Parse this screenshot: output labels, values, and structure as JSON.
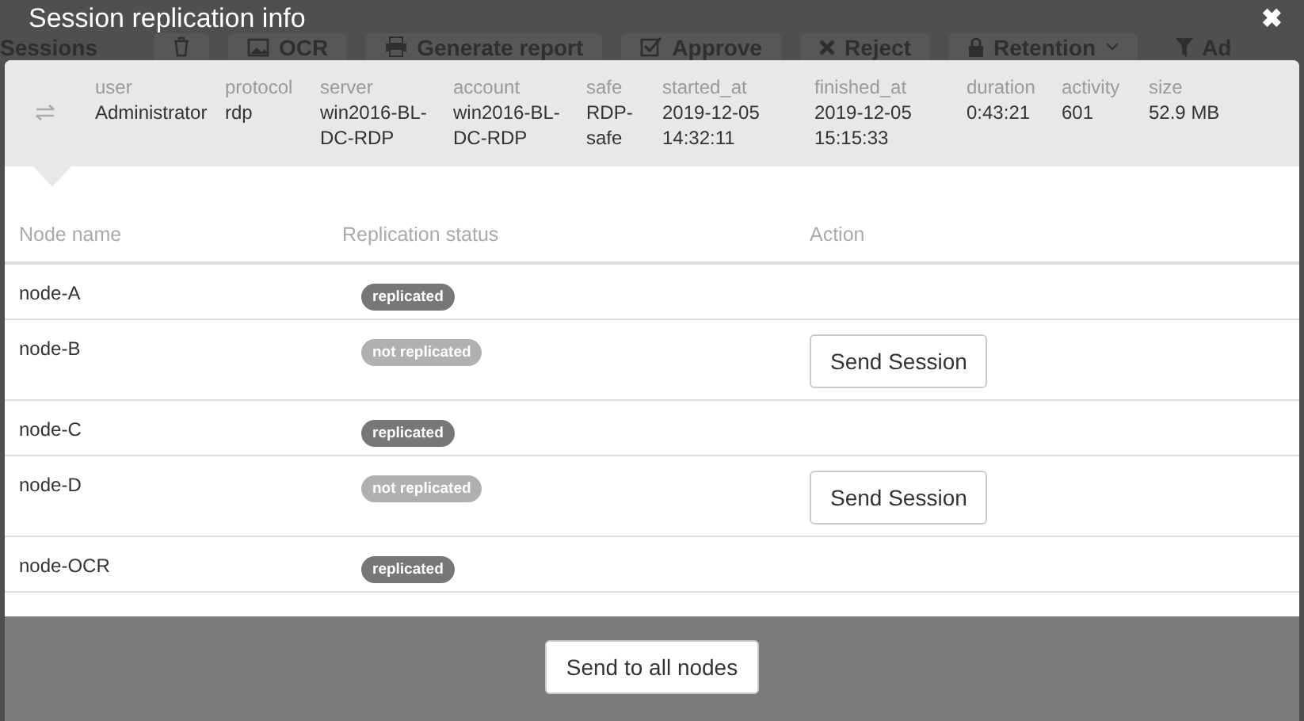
{
  "background": {
    "heading": "Sessions",
    "toolbar": [
      {
        "dropdown": false
      },
      {
        "label": "OCR",
        "dropdown": false
      },
      {
        "label": "Generate report",
        "dropdown": false
      },
      {
        "label": "Approve",
        "dropdown": false
      },
      {
        "label": "Reject",
        "dropdown": false
      },
      {
        "label": "Retention",
        "dropdown": true
      },
      {
        "label": "Ad",
        "dropdown": false
      }
    ]
  },
  "dialog": {
    "title": "Session replication info",
    "close": "✖",
    "session": [
      {
        "label": "user",
        "value": "Administrator"
      },
      {
        "label": "protocol",
        "value": "rdp"
      },
      {
        "label": "server",
        "value": "win2016-BL-DC-RDP"
      },
      {
        "label": "account",
        "value": "win2016-BL-DC-RDP"
      },
      {
        "label": "safe",
        "value": "RDP-safe"
      },
      {
        "label": "started_at",
        "value": "2019-12-05 14:32:11"
      },
      {
        "label": "finished_at",
        "value": "2019-12-05 15:15:33"
      },
      {
        "label": "duration",
        "value": "0:43:21"
      },
      {
        "label": "activity",
        "value": "601"
      },
      {
        "label": "size",
        "value": "52.9 MB"
      }
    ],
    "table": {
      "columns": [
        "Node name",
        "Replication status",
        "Action"
      ],
      "rows": [
        {
          "node": "node-A",
          "status": "replicated",
          "replicated": true
        },
        {
          "node": "node-B",
          "status": "not replicated",
          "replicated": false,
          "action": "Send Session"
        },
        {
          "node": "node-C",
          "status": "replicated",
          "replicated": true
        },
        {
          "node": "node-D",
          "status": "not replicated",
          "replicated": false,
          "action": "Send Session"
        },
        {
          "node": "node-OCR",
          "status": "replicated",
          "replicated": true
        }
      ]
    },
    "footer_button": "Send to all nodes"
  }
}
